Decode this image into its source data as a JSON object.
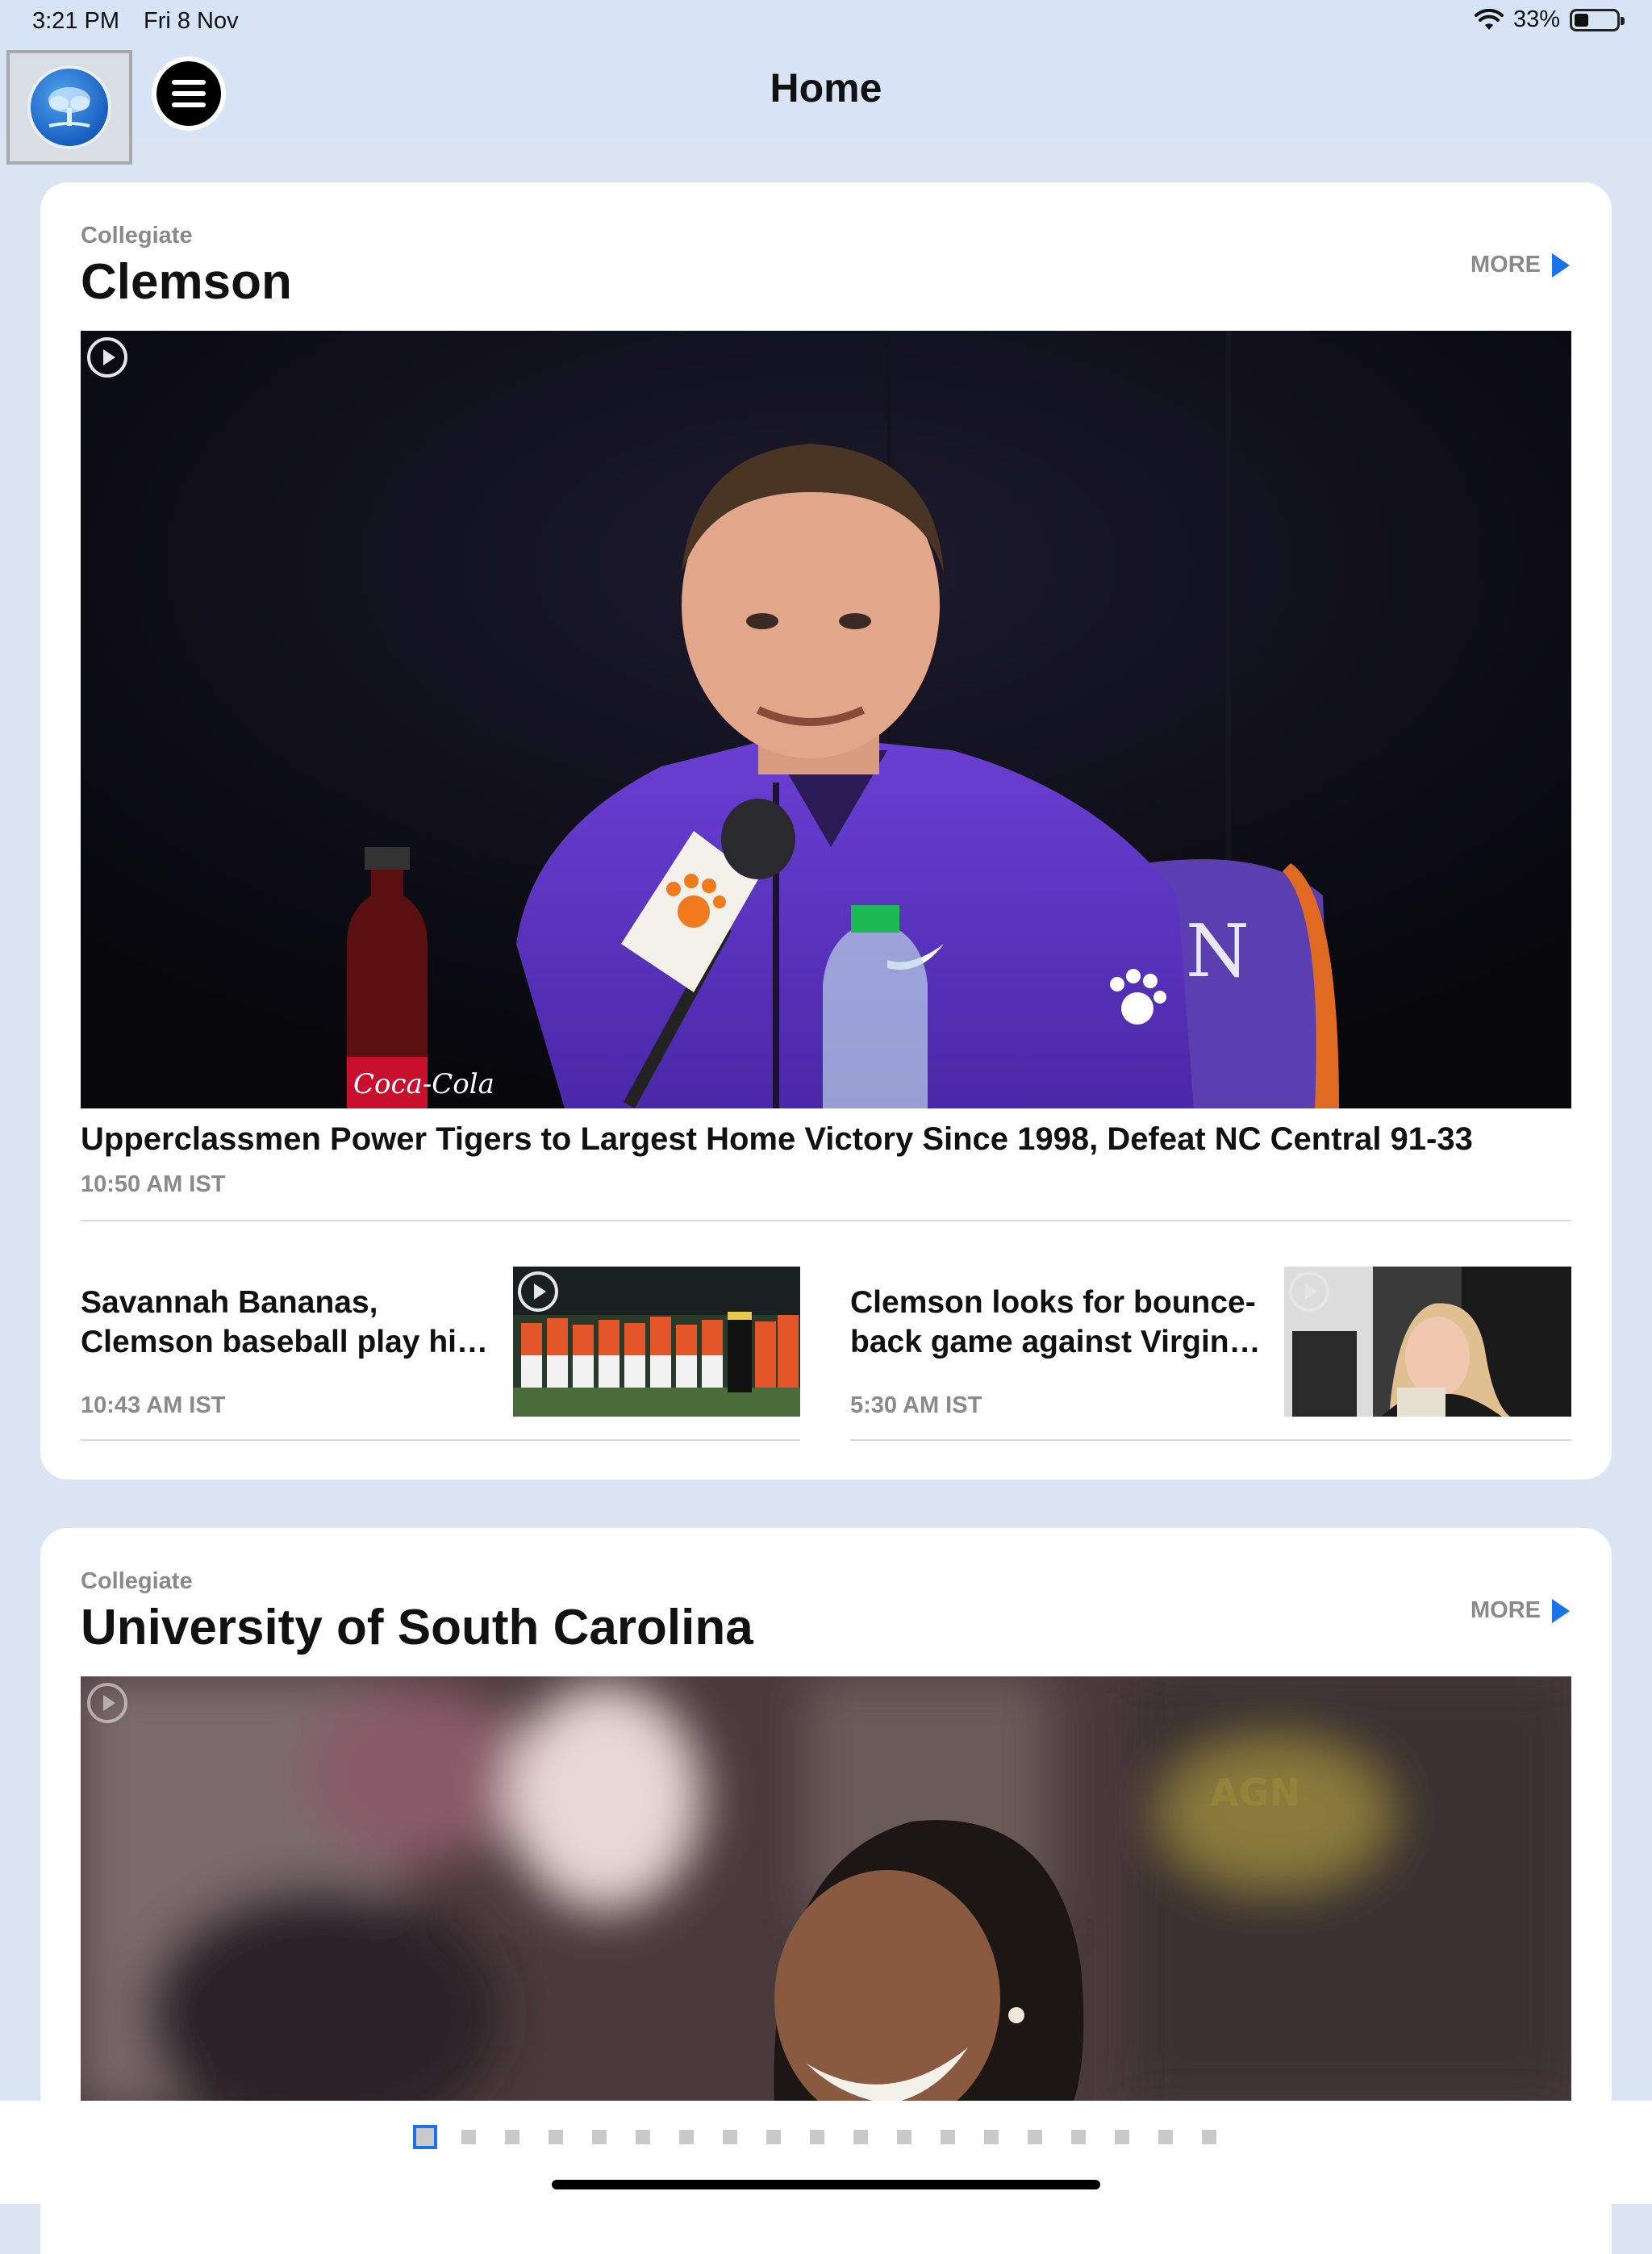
{
  "status_bar": {
    "time": "3:21 PM",
    "date": "Fri 8 Nov",
    "battery": "33%"
  },
  "nav": {
    "title": "Home",
    "logo_icon": "tree-logo-icon",
    "menu_icon": "hamburger-menu-icon"
  },
  "sections": [
    {
      "eyebrow": "Collegiate",
      "title": "Clemson",
      "more_label": "MORE",
      "featured": {
        "headline": "Upperclassmen Power Tigers to Largest Home Victory Since 1998, Defeat NC Central 91-33",
        "time": "10:50 AM IST"
      },
      "items": [
        {
          "headline_line1": "Savannah Bananas,",
          "headline_line2": "Clemson baseball play hi…",
          "time": "10:43 AM IST"
        },
        {
          "headline_line1": "Clemson looks for bounce-",
          "headline_line2": "back game against Virgin…",
          "time": "5:30 AM IST"
        }
      ]
    },
    {
      "eyebrow": "Collegiate",
      "title": "University of South Carolina",
      "more_label": "MORE"
    }
  ],
  "pager": {
    "total": 19,
    "current": 1
  },
  "colors": {
    "accent": "#1a73e8",
    "header_bg": "#d7e4f6",
    "page_bg": "#dbe4f2",
    "muted_text": "#8a8a8a"
  }
}
